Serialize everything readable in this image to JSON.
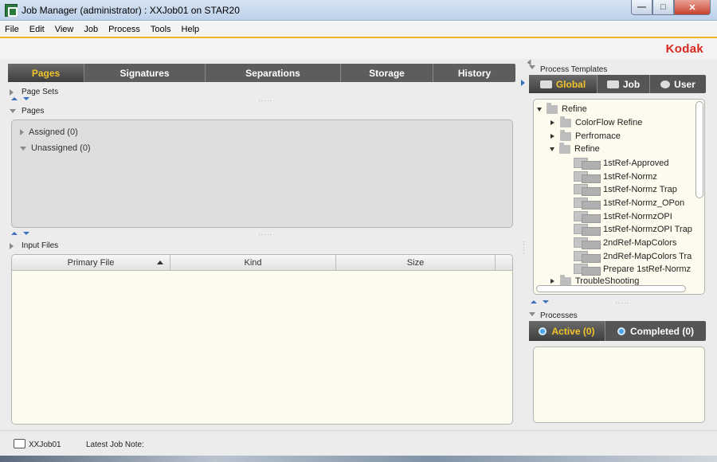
{
  "window": {
    "title": "Job Manager (administrator) : XXJob01 on STAR20",
    "minimize": "—",
    "maximize": "□",
    "close": "✕"
  },
  "menu": [
    "File",
    "Edit",
    "View",
    "Job",
    "Process",
    "Tools",
    "Help"
  ],
  "brand": {
    "logo": "Kodak",
    "color": "#d9281d"
  },
  "tabs": [
    {
      "label": "Pages",
      "active": true
    },
    {
      "label": "Signatures",
      "active": false
    },
    {
      "label": "Separations",
      "active": false
    },
    {
      "label": "Storage",
      "active": false
    },
    {
      "label": "History",
      "active": false
    }
  ],
  "sections": {
    "page_sets": "Page Sets",
    "pages": "Pages",
    "input_files": "Input Files"
  },
  "pages_groups": {
    "assigned": "Assigned (0)",
    "unassigned": "Unassigned (0)"
  },
  "input_files": {
    "columns": [
      "Primary File",
      "Kind",
      "Size"
    ],
    "rows": []
  },
  "process_templates": {
    "label": "Process Templates",
    "tabs": [
      {
        "label": "Global",
        "icon": "globe-icon",
        "active": true
      },
      {
        "label": "Job",
        "icon": "job-icon",
        "active": false
      },
      {
        "label": "User",
        "icon": "user-icon",
        "active": false
      }
    ],
    "tree": [
      {
        "label": "Refine",
        "type": "folder",
        "expanded": true
      },
      {
        "label": "ColorFlow Refine",
        "type": "folder",
        "expanded": false
      },
      {
        "label": "Perfromace",
        "type": "folder",
        "expanded": false
      },
      {
        "label": "Refine",
        "type": "folder",
        "expanded": true
      },
      {
        "label": "1stRef-Approved",
        "type": "process"
      },
      {
        "label": "1stRef-Normz",
        "type": "process"
      },
      {
        "label": "1stRef-Normz Trap",
        "type": "process"
      },
      {
        "label": "1stRef-Normz_OPon",
        "type": "process"
      },
      {
        "label": "1stRef-NormzOPI",
        "type": "process"
      },
      {
        "label": "1stRef-NormzOPI Trap",
        "type": "process"
      },
      {
        "label": "2ndRef-MapColors",
        "type": "process"
      },
      {
        "label": "2ndRef-MapColors Tra",
        "type": "process"
      },
      {
        "label": "Prepare 1stRef-Normz",
        "type": "process"
      },
      {
        "label": "TroubleShooting",
        "type": "folder",
        "expanded": false
      }
    ]
  },
  "processes": {
    "label": "Processes",
    "tabs": [
      {
        "label": "Active (0)",
        "active": true
      },
      {
        "label": "Completed (0)",
        "active": false
      }
    ]
  },
  "status": {
    "job": "XXJob01",
    "note_label": "Latest Job Note:"
  }
}
